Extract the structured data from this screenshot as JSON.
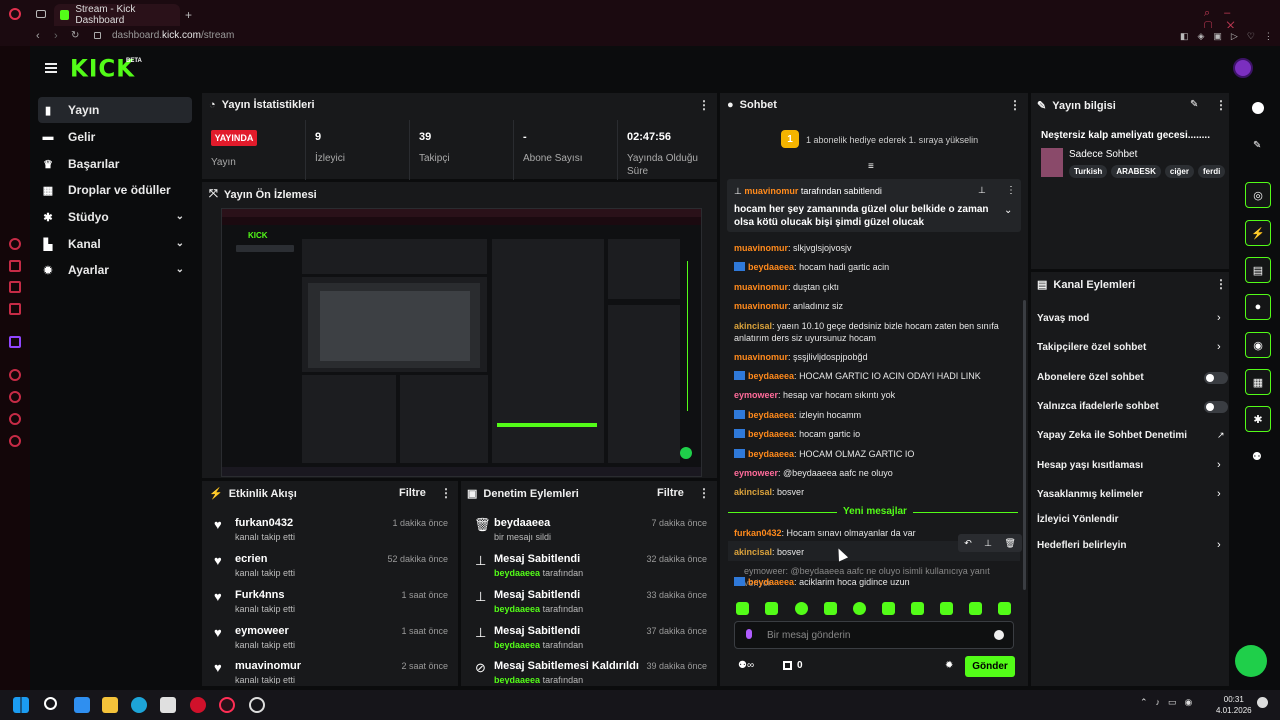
{
  "browser": {
    "tab_title": "Stream - Kick Dashboard",
    "url_prefix": "dashboard.",
    "url_host": "kick.com",
    "url_path": "/stream"
  },
  "brand": {
    "logo": "KICK",
    "beta": "BETA"
  },
  "nav": [
    {
      "label": "Yayın",
      "icon": "home-icon"
    },
    {
      "label": "Gelir",
      "icon": "wallet-icon"
    },
    {
      "label": "Başarılar",
      "icon": "trophy-icon"
    },
    {
      "label": "Droplar ve ödüller",
      "icon": "gift-icon"
    },
    {
      "label": "Stüdyo",
      "icon": "studio-icon"
    },
    {
      "label": "Kanal",
      "icon": "channel-icon"
    },
    {
      "label": "Ayarlar",
      "icon": "settings-icon"
    }
  ],
  "stats": {
    "title": "Yayın İstatistikleri",
    "live_badge": "YAYINDA",
    "live_label": "Yayın",
    "viewers_value": "9",
    "viewers_label": "İzleyici",
    "followers_value": "39",
    "followers_label": "Takipçi",
    "subs_value": "-",
    "subs_label": "Abone Sayısı",
    "duration_value": "02:47:56",
    "duration_label": "Yayında Olduğu Süre"
  },
  "preview": {
    "title": "Yayın Ön İzlemesi"
  },
  "activity": {
    "title": "Etkinlik Akışı",
    "filter": "Filtre",
    "items": [
      {
        "name": "furkan0432",
        "sub": "kanalı takip etti",
        "time": "1 dakika önce"
      },
      {
        "name": "ecrien",
        "sub": "kanalı takip etti",
        "time": "52 dakika önce"
      },
      {
        "name": "Furk4nns",
        "sub": "kanalı takip etti",
        "time": "1 saat önce"
      },
      {
        "name": "eymoweer",
        "sub": "kanalı takip etti",
        "time": "1 saat önce"
      },
      {
        "name": "muavinomur",
        "sub": "kanalı takip etti",
        "time": "2 saat önce"
      }
    ]
  },
  "moderation": {
    "title": "Denetim Eylemleri",
    "filter": "Filtre",
    "items": [
      {
        "name": "beydaaeea",
        "sub": "bir mesajı sildi",
        "time": "7 dakika önce",
        "icon": "trash-icon"
      },
      {
        "name": "Mesaj Sabitlendi",
        "user": "beydaaeea",
        "sub": "tarafından",
        "time": "32 dakika önce",
        "icon": "pin-icon"
      },
      {
        "name": "Mesaj Sabitlendi",
        "user": "beydaaeea",
        "sub": "tarafından",
        "time": "33 dakika önce",
        "icon": "pin-icon"
      },
      {
        "name": "Mesaj Sabitlendi",
        "user": "beydaaeea",
        "sub": "tarafından",
        "time": "37 dakika önce",
        "icon": "pin-icon"
      },
      {
        "name": "Mesaj Sabitlemesi Kaldırıldı",
        "user": "beydaaeea",
        "sub": "tarafından",
        "time": "39 dakika önce",
        "icon": "unpin-icon"
      }
    ]
  },
  "chat": {
    "title": "Sohbet",
    "gift_banner": "1 abonelik hediye ederek 1. sıraya yükselin",
    "gift_rank": "1",
    "pinned_by_user": "muavinomur",
    "pinned_by_text": "tarafından sabitlendi",
    "pinned_message": "hocam her şey zamanında güzel olur belkide o zaman olsa kötü olucak bişi şimdi güzel olucak",
    "messages": [
      {
        "user": "muavinomur",
        "color": "#ff8a1c",
        "badge": false,
        "text": "slkjvglsjojvosjv"
      },
      {
        "user": "beydaaeea",
        "color": "#ff8a1c",
        "badge": true,
        "text": "hocam hadi gartic acin"
      },
      {
        "user": "muavinomur",
        "color": "#ff8a1c",
        "badge": false,
        "text": "duştan çıktı"
      },
      {
        "user": "muavinomur",
        "color": "#ff8a1c",
        "badge": false,
        "text": "anladınız siz"
      },
      {
        "user": "akincisal",
        "color": "#d9a13b",
        "badge": false,
        "text": "yaeın 10.10 geçe dedsiniz bizle hocam zaten ben sınıfa anlatırım ders siz uyursunuz hocam"
      },
      {
        "user": "muavinomur",
        "color": "#ff8a1c",
        "badge": false,
        "text": "şsşjlivljdospjpobğd"
      },
      {
        "user": "beydaaeea",
        "color": "#ff8a1c",
        "badge": true,
        "text": "HOCAM GARTIC IO ACIN ODAYI HADI LINK"
      },
      {
        "user": "eymoweer",
        "color": "#ff6b9a",
        "badge": false,
        "text": "hesap var hocam sıkıntı yok"
      },
      {
        "user": "beydaaeea",
        "color": "#ff8a1c",
        "badge": true,
        "text": "izleyin hocamm"
      },
      {
        "user": "beydaaeea",
        "color": "#ff8a1c",
        "badge": true,
        "text": "hocam gartic io"
      },
      {
        "user": "beydaaeea",
        "color": "#ff8a1c",
        "badge": true,
        "text": "HOCAM OLMAZ GARTIC IO"
      },
      {
        "user": "eymoweer",
        "color": "#ff6b9a",
        "badge": false,
        "text": "@beydaaeea aafc ne oluyo"
      },
      {
        "user": "akincisal",
        "color": "#d9a13b",
        "badge": false,
        "text": "bosver"
      }
    ],
    "new_messages_label": "Yeni mesajlar",
    "new_messages": [
      {
        "user": "furkan0432",
        "color": "#ff8a1c",
        "badge": false,
        "text": "Hocam sınavı olmayanlar da var"
      },
      {
        "user": "akincisal",
        "color": "#d9a13b",
        "badge": false,
        "text": "bosver"
      }
    ],
    "reply_context": "eymoweer: @beydaaeea aafc ne oluyo isimli kullanıcıya yanıt veriyor",
    "reply_message": {
      "user": "beydaaeea",
      "text": "aciklarim hoca gidince uzun"
    },
    "input_placeholder": "Bir mesaj gönderin",
    "user_count": "0",
    "send_label": "Gönder"
  },
  "stream_info": {
    "title": "Yayın bilgisi",
    "stream_title": "Neştersiz kalp ameliyatı gecesi........",
    "category": "Sadece Sohbet",
    "tags": [
      "Turkish",
      "ARABESK",
      "ciğer",
      "ferdi"
    ]
  },
  "channel_actions": {
    "title": "Kanal Eylemleri",
    "items": [
      {
        "label": "Yavaş mod",
        "control": "chevron"
      },
      {
        "label": "Takipçilere özel sohbet",
        "control": "chevron"
      },
      {
        "label": "Abonelere özel sohbet",
        "control": "toggle"
      },
      {
        "label": "Yalnızca ifadelerle sohbet",
        "control": "toggle"
      },
      {
        "label": "Yapay Zeka ile Sohbet Denetimi",
        "control": "external"
      },
      {
        "label": "Hesap yaşı kısıtlaması",
        "control": "chevron"
      },
      {
        "label": "Yasaklanmış kelimeler",
        "control": "chevron"
      },
      {
        "label": "İzleyici Yönlendir",
        "control": "none"
      },
      {
        "label": "Hedefleri belirleyin",
        "control": "chevron"
      }
    ]
  },
  "taskbar": {
    "time": "00:31",
    "date": "4.01.2026"
  },
  "colors": {
    "brand": "#53fc18",
    "live": "#e21b2b",
    "panel": "#18191b"
  }
}
